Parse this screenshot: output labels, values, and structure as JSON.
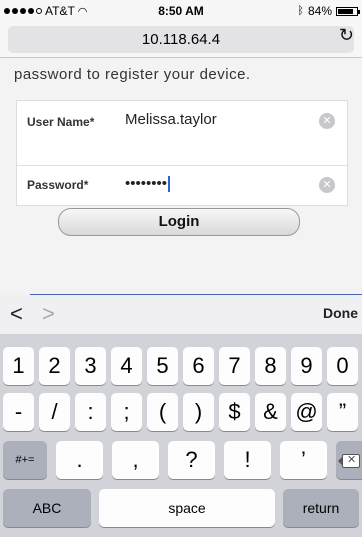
{
  "status_bar": {
    "carrier": "AT&T",
    "time": "8:50 AM",
    "battery": "84%",
    "battery_level": 0.84
  },
  "browser": {
    "url": "10.118.64.4"
  },
  "page": {
    "intro": "password to register your device.",
    "username_label": "User Name*",
    "username_value": "Melissa.taylor",
    "password_label": "Password*",
    "password_value": "••••••••",
    "login_label": "Login"
  },
  "accessory": {
    "prev": "<",
    "next": ">",
    "done": "Done"
  },
  "keyboard": {
    "row1": [
      "1",
      "2",
      "3",
      "4",
      "5",
      "6",
      "7",
      "8",
      "9",
      "0"
    ],
    "row2": [
      "-",
      "/",
      ":",
      ";",
      "(",
      ")",
      "$",
      "&",
      "@",
      "”"
    ],
    "row3_shift": "#+=",
    "row3": [
      ".",
      ",",
      "?",
      "!",
      "’"
    ],
    "abc": "ABC",
    "space": "space",
    "return": "return"
  }
}
